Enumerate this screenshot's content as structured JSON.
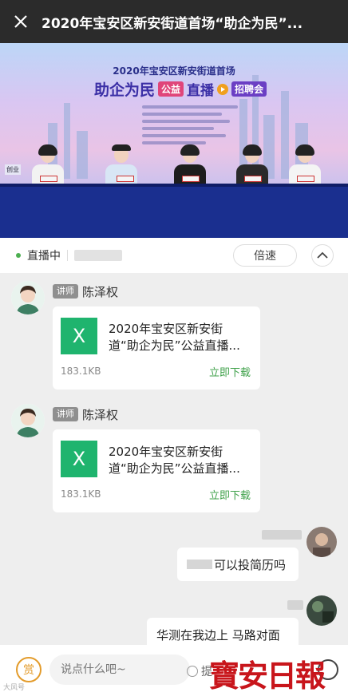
{
  "header": {
    "title": "2020年宝安区新安街道首场“助企为民”..."
  },
  "video": {
    "headline": "2020年宝安区新安街道首场",
    "banner_main": "助企为民",
    "banner_tag1": "公益",
    "banner_main2": "直播",
    "banner_tag2": "招聘会",
    "corner_logo": "创业"
  },
  "status": {
    "live_label": "直播中",
    "speed_label": "倍速"
  },
  "messages": [
    {
      "badge": "讲师",
      "name": "陈泽权",
      "file_name": "2020年宝安区新安街道“助企为民”公益直播...",
      "file_size": "183.1KB",
      "download_label": "立即下载"
    },
    {
      "badge": "讲师",
      "name": "陈泽权",
      "file_name": "2020年宝安区新安街道“助企为民”公益直播...",
      "file_size": "183.1KB",
      "download_label": "立即下载"
    }
  ],
  "user_messages": [
    {
      "text": "可以投简历吗"
    },
    {
      "text": "华测在我边上 马路对面"
    }
  ],
  "input": {
    "reward_label": "赏",
    "placeholder": "说点什么吧~",
    "ask_label": "提",
    "watermark": "寶安日報",
    "small_watermark": "大风号"
  }
}
